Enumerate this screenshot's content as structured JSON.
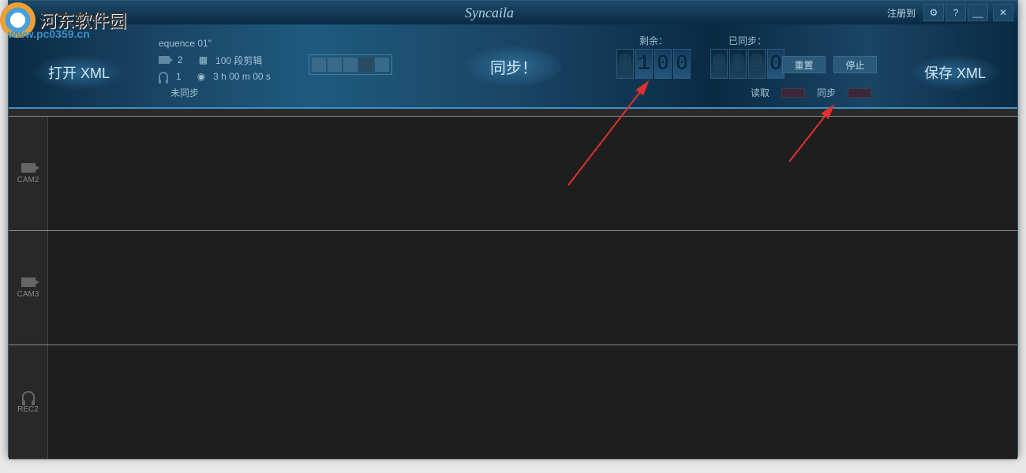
{
  "watermark": {
    "brand": "河东软件园",
    "url": "www.pc0359.cn"
  },
  "app": {
    "title": "Syncaila",
    "register": "注册到",
    "open_xml": "打开 XML",
    "save_xml": "保存 XML",
    "sync": "同步！",
    "sequence": "equence 01\"",
    "video_count": "2",
    "audio_count": "1",
    "clips": "100 段剪辑",
    "duration": "3 h 00 m 00 s",
    "sync_status": "未同步",
    "remaining_label": "剩余：",
    "synced_label": "已同步：",
    "remaining_value": "100",
    "synced_value": "0",
    "reset": "重置",
    "stop": "停止",
    "read_label": "读取",
    "sync_label": "同步"
  },
  "tracks": [
    {
      "name": "CAM2",
      "type": "video"
    },
    {
      "name": "CAM3",
      "type": "video"
    },
    {
      "name": "REC2",
      "type": "audio"
    }
  ]
}
